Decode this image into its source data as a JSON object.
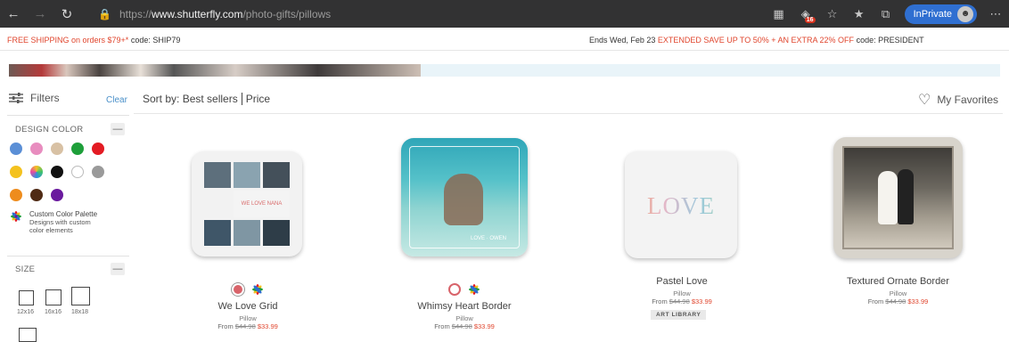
{
  "browser": {
    "url_prefix": "https://",
    "url_domain": "www.shutterfly.com",
    "url_path": "/photo-gifts/pillows",
    "badge_count": "16",
    "inprivate_label": "InPrivate"
  },
  "promo": {
    "left_red": "FREE SHIPPING on orders $79+*",
    "left_code": " code: SHIP79",
    "right_prefix": "Ends Wed, Feb 23 ",
    "right_red": "EXTENDED SAVE UP TO 50% + AN EXTRA 22% OFF",
    "right_code": " code: PRESIDENT"
  },
  "filters": {
    "title": "Filters",
    "clear_label": "Clear",
    "design_color_label": "DESIGN COLOR",
    "size_label": "SIZE",
    "color_rows": [
      [
        "#5b8fd6",
        "#e88dbf",
        "#d8c1a4",
        "#1e9f3a",
        "#e31b23"
      ],
      [
        "#f4c21f",
        "gradient",
        "#111111",
        "#ffffff",
        "#9a9a9a"
      ],
      [
        "#ee8c1d",
        "#4f2a14",
        "#6a1a9e"
      ]
    ],
    "palette_title": "Custom Color Palette",
    "palette_desc_1": "Designs with custom",
    "palette_desc_2": "color elements",
    "sizes": [
      "12x16",
      "16x16",
      "18x18"
    ]
  },
  "sort": {
    "label": "Sort by:",
    "best": "Best sellers",
    "price": "Price",
    "favorites": "My Favorites"
  },
  "products": [
    {
      "name": "We Love Grid",
      "type": "Pillow",
      "from": "From ",
      "old_price": "$44.98",
      "new_price": "$33.99",
      "caption": "WE LOVE NANA",
      "chip_color": "#d8636a"
    },
    {
      "name": "Whimsy Heart Border",
      "type": "Pillow",
      "from": "From ",
      "old_price": "$44.98",
      "new_price": "$33.99",
      "caption": "LOVE · OWEN",
      "chip_color": "#ffffff"
    },
    {
      "name": "Pastel Love",
      "type": "Pillow",
      "from": "From ",
      "old_price": "$44.98",
      "new_price": "$33.99",
      "caption": "LOVE",
      "badge": "ART LIBRARY"
    },
    {
      "name": "Textured Ornate Border",
      "type": "Pillow",
      "from": "From ",
      "old_price": "$44.98",
      "new_price": "$33.99",
      "caption": ""
    }
  ]
}
